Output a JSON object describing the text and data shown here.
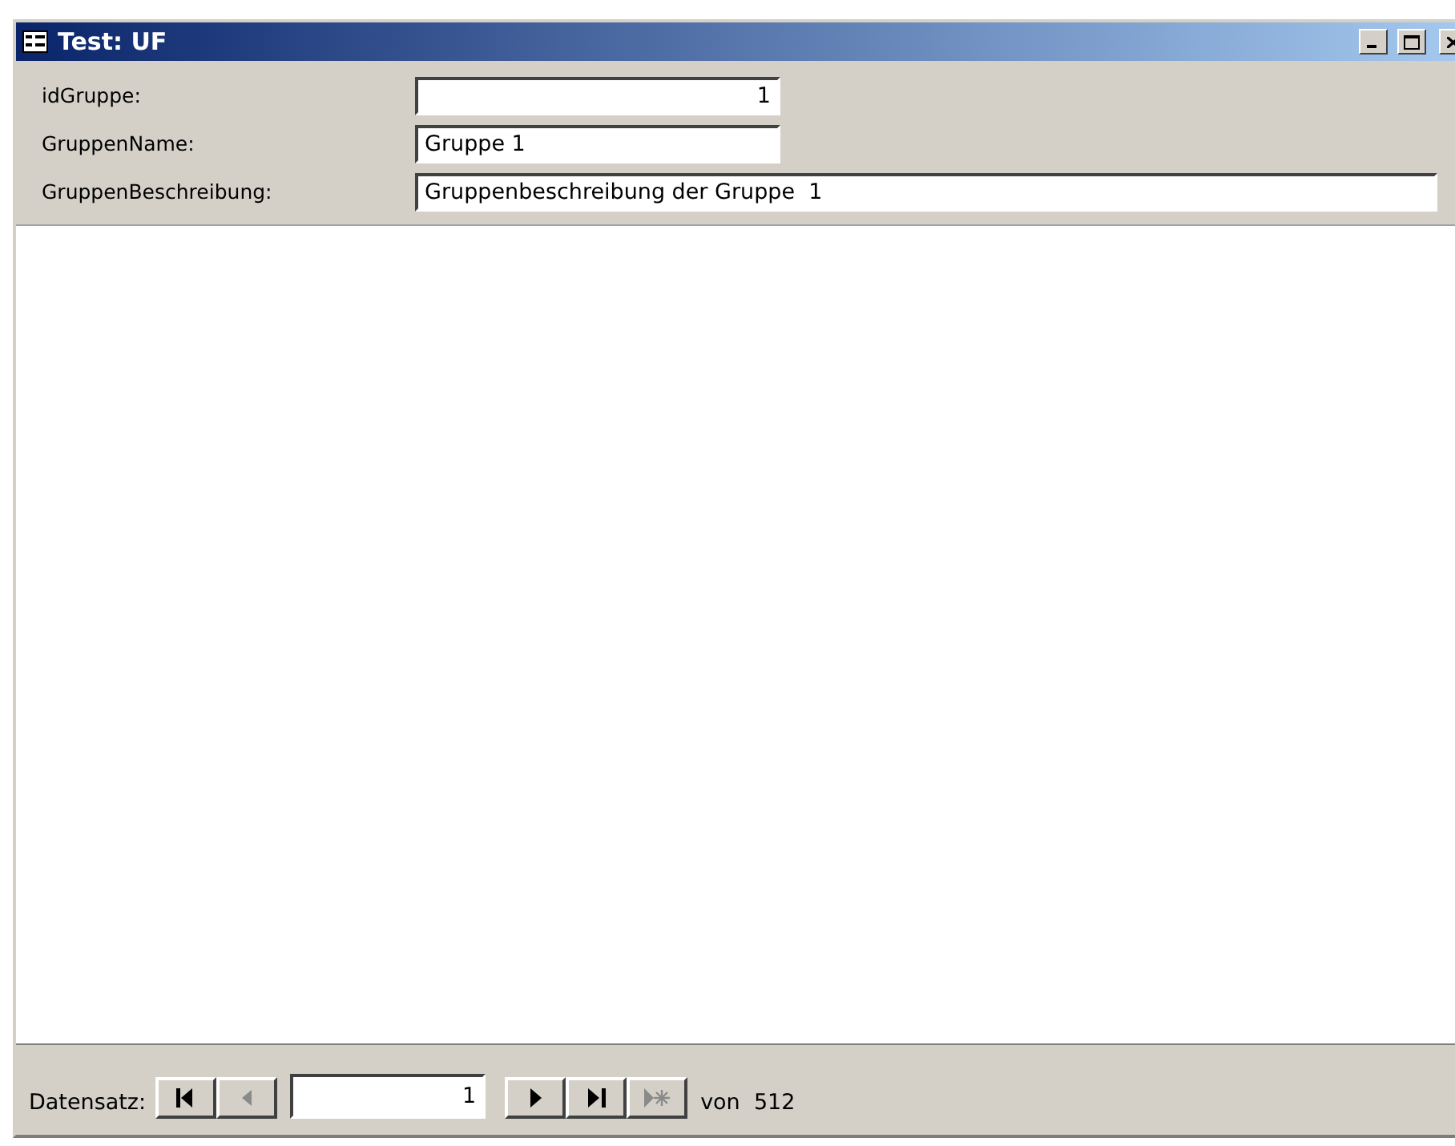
{
  "window": {
    "title": "Test: UF"
  },
  "fields": [
    {
      "label": "idGruppe:",
      "value": "1",
      "kind": "number"
    },
    {
      "label": "GruppenName:",
      "value": "Gruppe 1",
      "kind": "text"
    },
    {
      "label": "GruppenBeschreibung:",
      "value": "Gruppenbeschreibung der Gruppe  1",
      "kind": "memo"
    }
  ],
  "navigation": {
    "label": "Datensatz:",
    "record": "1",
    "total": "von  512",
    "left_buttons": [
      {
        "kind": "first",
        "disabled": false
      },
      {
        "kind": "previous",
        "disabled": true
      }
    ],
    "right_buttons": [
      {
        "kind": "next",
        "disabled": false
      },
      {
        "kind": "last",
        "disabled": false
      },
      {
        "kind": "new",
        "disabled": true
      }
    ]
  }
}
